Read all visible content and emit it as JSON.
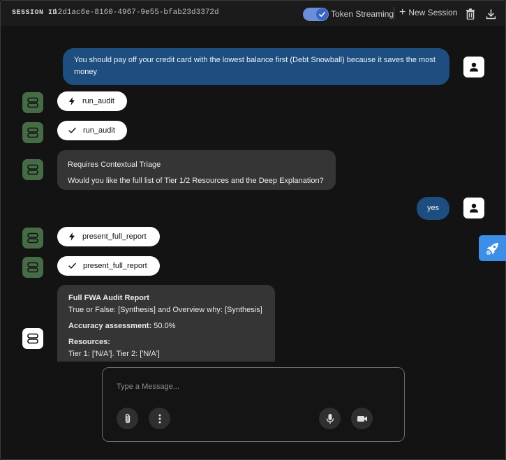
{
  "header": {
    "session_label": "SESSION ID",
    "session_id": "12d1ac6e-8160-4967-9e55-bfab23d3372d",
    "token_streaming_label": "Token Streaming",
    "token_streaming_on": true,
    "new_session_label": "New Session"
  },
  "messages": [
    {
      "role": "user",
      "text": "You should pay off your credit card with the lowest balance first (Debt Snowball) because it saves the most money"
    },
    {
      "role": "tool",
      "status": "running",
      "icon": "bolt-icon",
      "label": "run_audit"
    },
    {
      "role": "tool",
      "status": "done",
      "icon": "check-icon",
      "label": "run_audit"
    },
    {
      "role": "assistant",
      "lines": [
        "Requires Contextual Triage",
        "Would you like the full list of Tier 1/2 Resources and the Deep Explanation?"
      ]
    },
    {
      "role": "user",
      "text": "yes"
    },
    {
      "role": "tool",
      "status": "running",
      "icon": "bolt-icon",
      "label": "present_full_report"
    },
    {
      "role": "tool",
      "status": "done",
      "icon": "check-icon",
      "label": "present_full_report"
    },
    {
      "role": "assistant",
      "report": {
        "title": "Full FWA Audit Report",
        "overview": "True or False: [Synthesis] and Overview why: [Synthesis]",
        "accuracy_label": "Accuracy assessment:",
        "accuracy_value": " 50.0%",
        "resources_label": "Resources:",
        "resources_value": "Tier 1: ['N/A']. Tier 2: ['N/A']"
      }
    }
  ],
  "composer": {
    "placeholder": "Type a Message..."
  },
  "colors": {
    "accent": "#3d8ee6",
    "user_bubble": "#1d4e7f",
    "bot_avatar": "#466c46",
    "assistant_bubble": "#353535"
  }
}
